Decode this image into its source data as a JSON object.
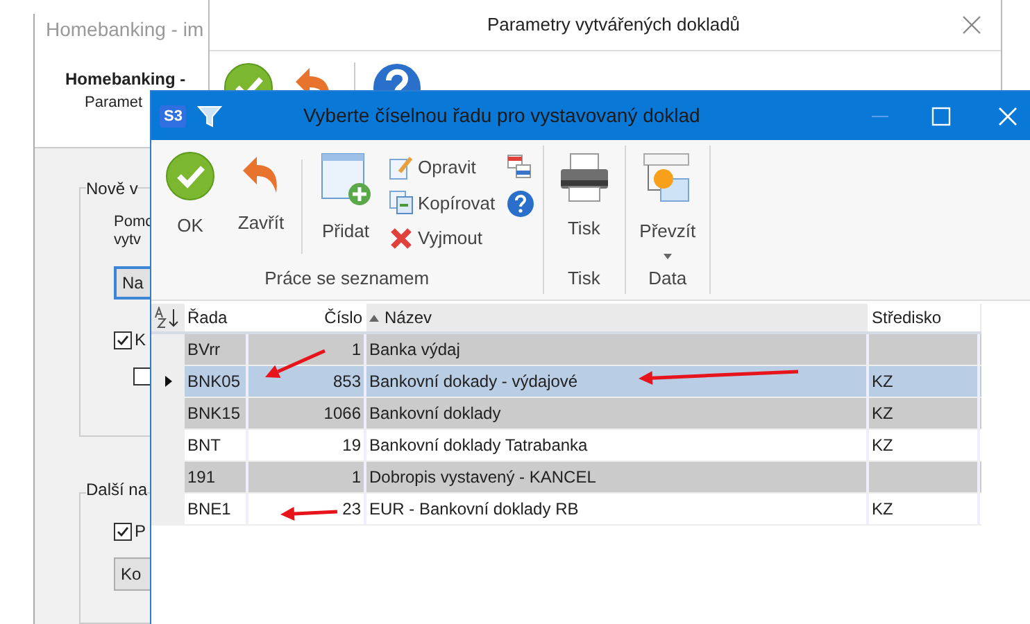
{
  "back_window": {
    "title": "Homebanking - im",
    "heading": "Homebanking -",
    "subheading": "Paramet",
    "group_new": {
      "title": "Nově v",
      "text_lines": [
        "Pomc",
        "vytv"
      ],
      "button": "Na",
      "checkboxes": [
        {
          "label": "K",
          "checked": true
        },
        {
          "checked": false
        }
      ]
    },
    "group_other": {
      "title": "Další na",
      "checkbox": {
        "label": "P",
        "checked": true
      },
      "button": "Ko"
    }
  },
  "middle_window": {
    "title": "Parametry vytvářených dokladů"
  },
  "front_window": {
    "app_badge": "S3",
    "title": "Vyberte číselnou řadu pro vystavovaný doklad",
    "ribbon": [
      {
        "label": "Práce se seznamem",
        "large_buttons": [
          {
            "kind": "ok",
            "label": "OK"
          },
          {
            "kind": "back",
            "label": "Zavřít"
          },
          {
            "kind": "add",
            "label": "Přidat"
          }
        ],
        "small_buttons": [
          {
            "kind": "edit",
            "label": "Opravit"
          },
          {
            "kind": "copy",
            "label": "Kopírovat"
          },
          {
            "kind": "delete",
            "label": "Vyjmout"
          }
        ],
        "extra_icons": [
          {
            "kind": "transfer"
          },
          {
            "kind": "help"
          }
        ]
      },
      {
        "label": "Tisk",
        "large_buttons": [
          {
            "kind": "print",
            "label": "Tisk"
          }
        ]
      },
      {
        "label": "Data",
        "large_buttons": [
          {
            "kind": "import",
            "label": "Převzít",
            "dropdown": true
          }
        ]
      }
    ],
    "table": {
      "columns": [
        "Řada",
        "Číslo",
        "Název",
        "Středisko"
      ],
      "rows": [
        {
          "rada": "BVrr",
          "cislo": "1",
          "nazev": "Banka výdaj",
          "selected": false,
          "shaded": true
        },
        {
          "rada": "BNK05",
          "cislo": "853",
          "nazev": "Bankovní dokady - výdajové",
          "stredisko": "KZ",
          "selected": true
        },
        {
          "rada": "BNK15",
          "cislo": "1066",
          "nazev": "Bankovní doklady",
          "stredisko": "KZ",
          "selected": false,
          "shaded": true
        },
        {
          "rada": "BNT",
          "cislo": "19",
          "nazev": "Bankovní doklady Tatrabanka",
          "stredisko": "KZ",
          "selected": false,
          "shaded": false
        },
        {
          "rada": "191",
          "cislo": "1",
          "nazev": "Dobropis vystavený - KANCEL",
          "selected": false,
          "shaded": true
        },
        {
          "rada": "BNE1",
          "cislo": "23",
          "nazev": "EUR - Bankovní doklady RB",
          "stredisko": "KZ",
          "selected": false,
          "shaded": false
        }
      ]
    }
  }
}
